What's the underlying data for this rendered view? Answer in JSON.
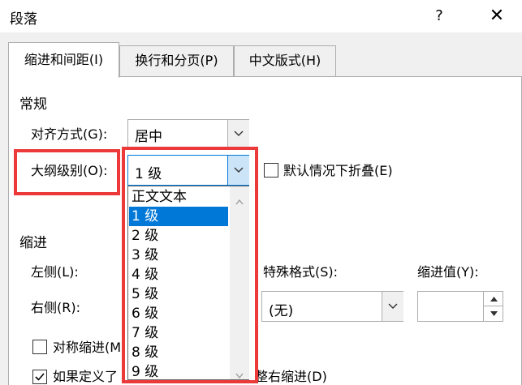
{
  "window": {
    "title": "段落",
    "help_glyph": "?",
    "close_glyph": "✕"
  },
  "tabs": [
    {
      "label": "缩进和间距(I)",
      "active": true
    },
    {
      "label": "换行和分页(P)",
      "active": false
    },
    {
      "label": "中文版式(H)",
      "active": false
    }
  ],
  "general": {
    "section_label": "常规",
    "alignment_label": "对齐方式(G):",
    "alignment_value": "居中",
    "outline_label": "大纲级别(O):",
    "outline_value": "1 级",
    "collapse_label": "默认情况下折叠(E)"
  },
  "outline_options": [
    "正文文本",
    "1 级",
    "2 级",
    "3 级",
    "4 级",
    "5 级",
    "6 级",
    "7 级",
    "8 级",
    "9 级"
  ],
  "outline_selected_index": 1,
  "indent": {
    "section_label": "缩进",
    "left_label": "左侧(L):",
    "right_label": "右侧(R):",
    "special_label": "特殊格式(S):",
    "special_value": "(无)",
    "indent_value_label": "缩进值(Y):",
    "mirror_label": "对称缩进(M",
    "grid_label_left": "如果定义了",
    "grid_label_right": "整右缩进(D)"
  },
  "colors": {
    "highlight": "#ec3a3a",
    "selection": "#0078d7"
  }
}
